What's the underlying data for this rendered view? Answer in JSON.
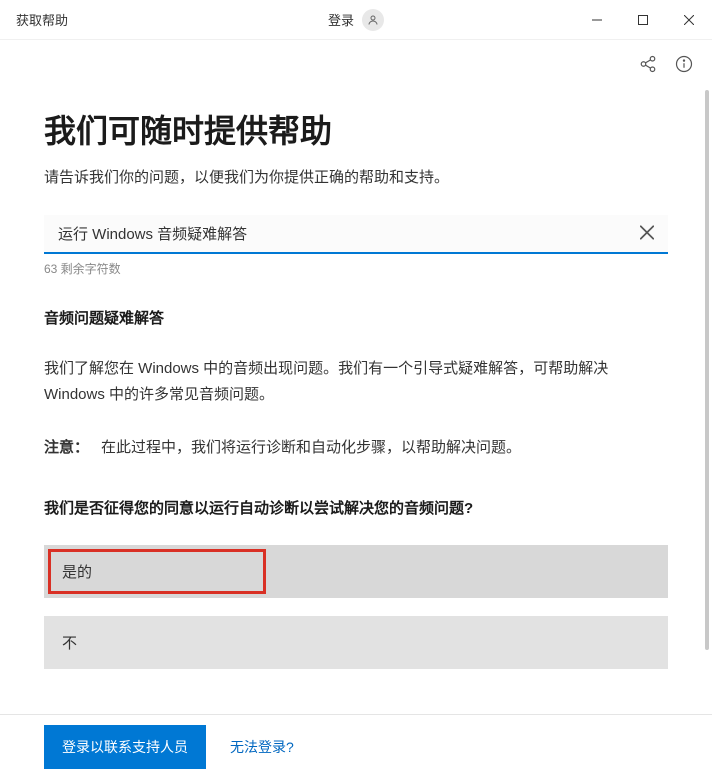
{
  "titlebar": {
    "app_name": "获取帮助",
    "login_label": "登录"
  },
  "main": {
    "title": "我们可随时提供帮助",
    "subtitle": "请告诉我们你的问题，以便我们为你提供正确的帮助和支持。"
  },
  "search": {
    "value": "运行 Windows 音频疑难解答",
    "char_count": "63 剩余字符数"
  },
  "section": {
    "heading": "音频问题疑难解答",
    "body": "我们了解您在 Windows 中的音频出现问题。我们有一个引导式疑难解答，可帮助解决 Windows 中的许多常见音频问题。",
    "note_label": "注意：",
    "note_text": "在此过程中，我们将运行诊断和自动化步骤，以帮助解决问题。"
  },
  "question": {
    "text": "我们是否征得您的同意以运行自动诊断以尝试解决您的音频问题?",
    "option_yes": "是的",
    "option_no": "不"
  },
  "footer": {
    "primary_button": "登录以联系支持人员",
    "link": "无法登录?"
  }
}
